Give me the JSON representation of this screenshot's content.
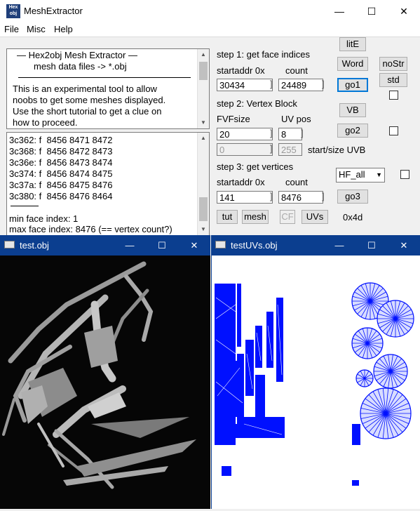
{
  "window": {
    "title": "MeshExtractor",
    "icon_text": "Hex obj"
  },
  "menu": [
    "File",
    "Misc",
    "Help"
  ],
  "intro": {
    "lines": [
      "—   Hex2obj Mesh Extractor   —",
      "mesh data files -> *.obj",
      "This is an experimental tool to allow",
      "noobs to get some meshes displayed.",
      "Use the short tutorial to get a clue on",
      "how to proceed."
    ]
  },
  "log": {
    "lines": [
      "3c362: f  8456 8471 8472",
      "3c368: f  8456 8472 8473",
      "3c36e: f  8456 8473 8474",
      "3c374: f  8456 8474 8475",
      "3c37a: f  8456 8475 8476",
      "3c380: f  8456 8476 8464"
    ],
    "min_line": "min face index: 1",
    "max_line": "max face index: 8476 (== vertex count?)"
  },
  "step1": {
    "title": "step 1: get face indices",
    "startaddr_label": "startaddr 0x",
    "count_label": "count",
    "startaddr": "30434",
    "count": "24489"
  },
  "step2": {
    "title": "step 2: Vertex Block",
    "fvf_label": "FVFsize",
    "uvpos_label": "UV pos",
    "fvf": "20",
    "uvpos": "8",
    "uvb_start": "0",
    "uvb_size": "255",
    "uvb_label": "start/size UVB"
  },
  "step3": {
    "title": "step 3: get vertices",
    "startaddr_label": "startaddr 0x",
    "count_label": "count",
    "startaddr": "141",
    "count": "8476"
  },
  "buttons": {
    "lite": "litE",
    "word": "Word",
    "go1": "go1",
    "vb": "VB",
    "go2": "go2",
    "go3": "go3",
    "nostr": "noStr",
    "std": "std",
    "tut": "tut",
    "mesh": "mesh",
    "cf": "CF",
    "uvs": "UVs"
  },
  "select_hf": "HF_all",
  "hex_readout": "0x4d",
  "windows": {
    "test_obj": "test.obj",
    "test_uvs": "testUVs.obj"
  },
  "caption": {
    "minimize": "—",
    "maximize": "☐",
    "close": "✕"
  },
  "colors": {
    "uv_blue": "#0010ff",
    "titlebar_blue": "#0b3e8f",
    "viewport_bg": "#060606"
  }
}
